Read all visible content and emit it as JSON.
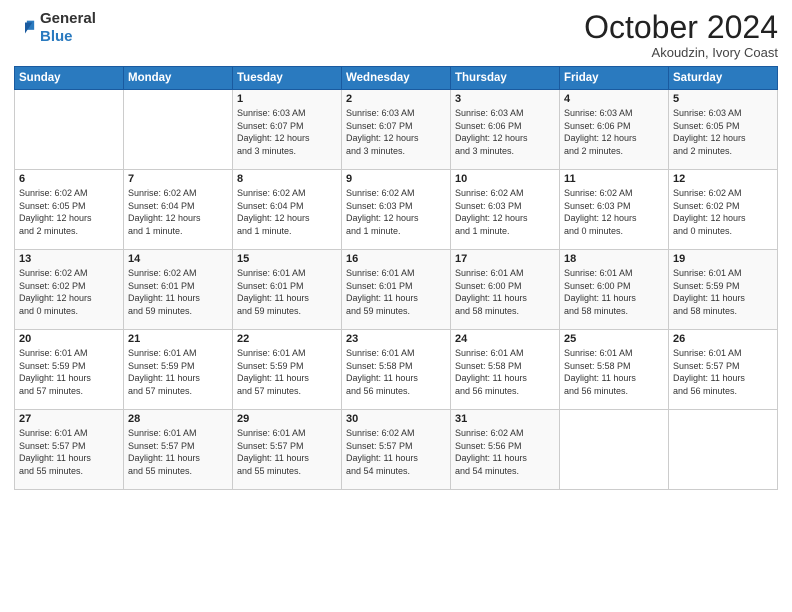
{
  "logo": {
    "general": "General",
    "blue": "Blue"
  },
  "header": {
    "month": "October 2024",
    "location": "Akoudzin, Ivory Coast"
  },
  "days_of_week": [
    "Sunday",
    "Monday",
    "Tuesday",
    "Wednesday",
    "Thursday",
    "Friday",
    "Saturday"
  ],
  "weeks": [
    [
      {
        "day": "",
        "content": ""
      },
      {
        "day": "",
        "content": ""
      },
      {
        "day": "1",
        "content": "Sunrise: 6:03 AM\nSunset: 6:07 PM\nDaylight: 12 hours\nand 3 minutes."
      },
      {
        "day": "2",
        "content": "Sunrise: 6:03 AM\nSunset: 6:07 PM\nDaylight: 12 hours\nand 3 minutes."
      },
      {
        "day": "3",
        "content": "Sunrise: 6:03 AM\nSunset: 6:06 PM\nDaylight: 12 hours\nand 3 minutes."
      },
      {
        "day": "4",
        "content": "Sunrise: 6:03 AM\nSunset: 6:06 PM\nDaylight: 12 hours\nand 2 minutes."
      },
      {
        "day": "5",
        "content": "Sunrise: 6:03 AM\nSunset: 6:05 PM\nDaylight: 12 hours\nand 2 minutes."
      }
    ],
    [
      {
        "day": "6",
        "content": "Sunrise: 6:02 AM\nSunset: 6:05 PM\nDaylight: 12 hours\nand 2 minutes."
      },
      {
        "day": "7",
        "content": "Sunrise: 6:02 AM\nSunset: 6:04 PM\nDaylight: 12 hours\nand 1 minute."
      },
      {
        "day": "8",
        "content": "Sunrise: 6:02 AM\nSunset: 6:04 PM\nDaylight: 12 hours\nand 1 minute."
      },
      {
        "day": "9",
        "content": "Sunrise: 6:02 AM\nSunset: 6:03 PM\nDaylight: 12 hours\nand 1 minute."
      },
      {
        "day": "10",
        "content": "Sunrise: 6:02 AM\nSunset: 6:03 PM\nDaylight: 12 hours\nand 1 minute."
      },
      {
        "day": "11",
        "content": "Sunrise: 6:02 AM\nSunset: 6:03 PM\nDaylight: 12 hours\nand 0 minutes."
      },
      {
        "day": "12",
        "content": "Sunrise: 6:02 AM\nSunset: 6:02 PM\nDaylight: 12 hours\nand 0 minutes."
      }
    ],
    [
      {
        "day": "13",
        "content": "Sunrise: 6:02 AM\nSunset: 6:02 PM\nDaylight: 12 hours\nand 0 minutes."
      },
      {
        "day": "14",
        "content": "Sunrise: 6:02 AM\nSunset: 6:01 PM\nDaylight: 11 hours\nand 59 minutes."
      },
      {
        "day": "15",
        "content": "Sunrise: 6:01 AM\nSunset: 6:01 PM\nDaylight: 11 hours\nand 59 minutes."
      },
      {
        "day": "16",
        "content": "Sunrise: 6:01 AM\nSunset: 6:01 PM\nDaylight: 11 hours\nand 59 minutes."
      },
      {
        "day": "17",
        "content": "Sunrise: 6:01 AM\nSunset: 6:00 PM\nDaylight: 11 hours\nand 58 minutes."
      },
      {
        "day": "18",
        "content": "Sunrise: 6:01 AM\nSunset: 6:00 PM\nDaylight: 11 hours\nand 58 minutes."
      },
      {
        "day": "19",
        "content": "Sunrise: 6:01 AM\nSunset: 5:59 PM\nDaylight: 11 hours\nand 58 minutes."
      }
    ],
    [
      {
        "day": "20",
        "content": "Sunrise: 6:01 AM\nSunset: 5:59 PM\nDaylight: 11 hours\nand 57 minutes."
      },
      {
        "day": "21",
        "content": "Sunrise: 6:01 AM\nSunset: 5:59 PM\nDaylight: 11 hours\nand 57 minutes."
      },
      {
        "day": "22",
        "content": "Sunrise: 6:01 AM\nSunset: 5:59 PM\nDaylight: 11 hours\nand 57 minutes."
      },
      {
        "day": "23",
        "content": "Sunrise: 6:01 AM\nSunset: 5:58 PM\nDaylight: 11 hours\nand 56 minutes."
      },
      {
        "day": "24",
        "content": "Sunrise: 6:01 AM\nSunset: 5:58 PM\nDaylight: 11 hours\nand 56 minutes."
      },
      {
        "day": "25",
        "content": "Sunrise: 6:01 AM\nSunset: 5:58 PM\nDaylight: 11 hours\nand 56 minutes."
      },
      {
        "day": "26",
        "content": "Sunrise: 6:01 AM\nSunset: 5:57 PM\nDaylight: 11 hours\nand 56 minutes."
      }
    ],
    [
      {
        "day": "27",
        "content": "Sunrise: 6:01 AM\nSunset: 5:57 PM\nDaylight: 11 hours\nand 55 minutes."
      },
      {
        "day": "28",
        "content": "Sunrise: 6:01 AM\nSunset: 5:57 PM\nDaylight: 11 hours\nand 55 minutes."
      },
      {
        "day": "29",
        "content": "Sunrise: 6:01 AM\nSunset: 5:57 PM\nDaylight: 11 hours\nand 55 minutes."
      },
      {
        "day": "30",
        "content": "Sunrise: 6:02 AM\nSunset: 5:57 PM\nDaylight: 11 hours\nand 54 minutes."
      },
      {
        "day": "31",
        "content": "Sunrise: 6:02 AM\nSunset: 5:56 PM\nDaylight: 11 hours\nand 54 minutes."
      },
      {
        "day": "",
        "content": ""
      },
      {
        "day": "",
        "content": ""
      }
    ]
  ]
}
